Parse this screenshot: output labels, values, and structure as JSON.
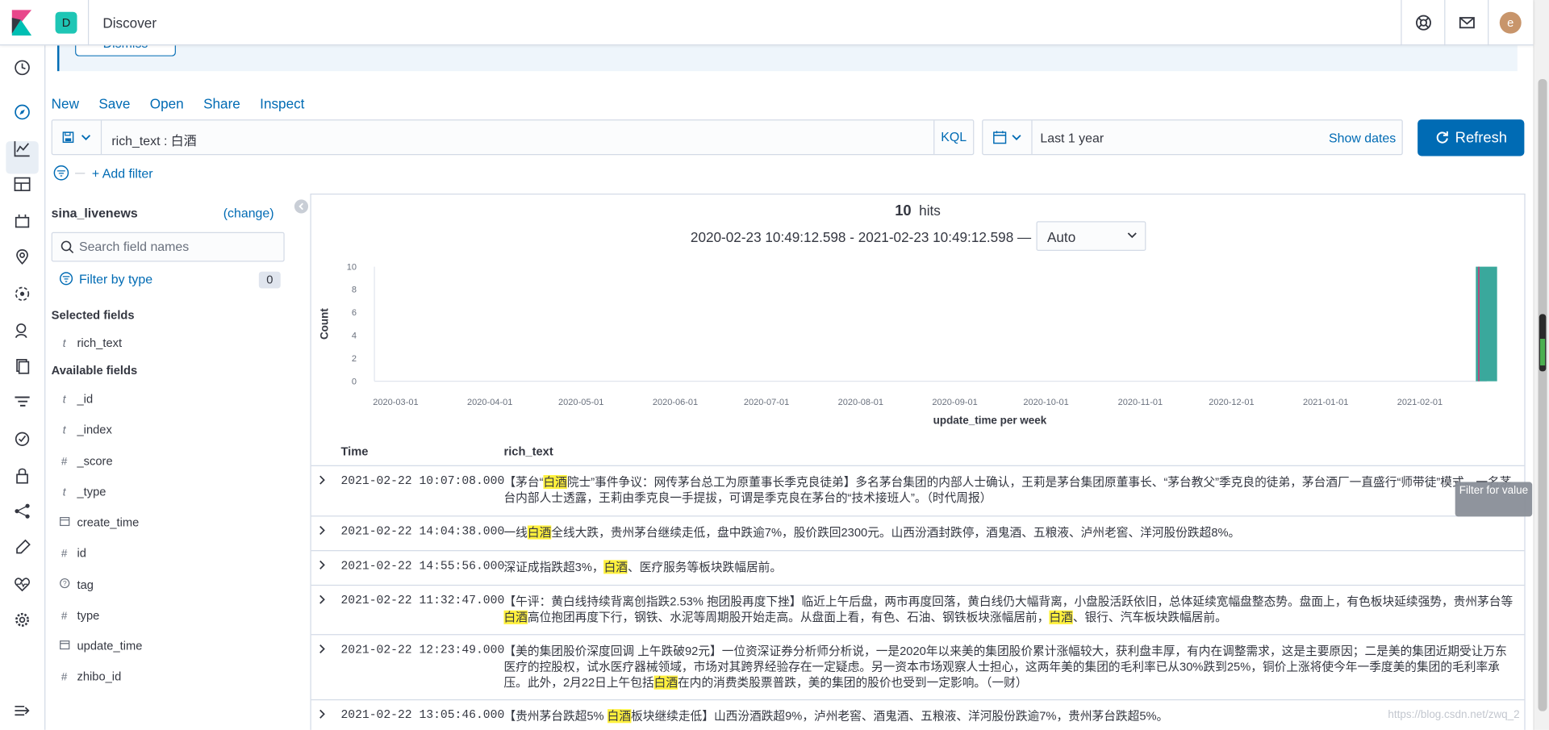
{
  "header": {
    "space_initial": "D",
    "title": "Discover",
    "user_initial": "e"
  },
  "callout": {
    "dismiss_label": "Dismiss"
  },
  "top_menu": [
    "New",
    "Save",
    "Open",
    "Share",
    "Inspect"
  ],
  "query": {
    "text": "rich_text : 白酒",
    "language": "KQL"
  },
  "date": {
    "range": "Last 1 year",
    "show_dates": "Show dates"
  },
  "refresh_label": "Refresh",
  "add_filter": "+ Add filter",
  "sidebar": {
    "index_pattern": "sina_livenews",
    "change": "(change)",
    "search_placeholder": "Search field names",
    "filter_by_type": "Filter by type",
    "filter_count": "0",
    "selected_title": "Selected fields",
    "selected_fields": [
      {
        "type": "t",
        "name": "rich_text"
      }
    ],
    "available_title": "Available fields",
    "available_fields": [
      {
        "type": "t",
        "name": "_id"
      },
      {
        "type": "t",
        "name": "_index"
      },
      {
        "type": "#",
        "name": "_score"
      },
      {
        "type": "t",
        "name": "_type"
      },
      {
        "type": "date",
        "name": "create_time"
      },
      {
        "type": "#",
        "name": "id"
      },
      {
        "type": "?",
        "name": "tag"
      },
      {
        "type": "#",
        "name": "type"
      },
      {
        "type": "date",
        "name": "update_time"
      },
      {
        "type": "#",
        "name": "zhibo_id"
      }
    ]
  },
  "results": {
    "hits": "10",
    "hits_label": "hits",
    "date_range": "2020-02-23 10:49:12.598 - 2021-02-23 10:49:12.598 —",
    "interval": "Auto"
  },
  "chart_data": {
    "type": "bar",
    "ylabel": "Count",
    "xlabel": "update_time per week",
    "ylim": [
      0,
      10
    ],
    "yticks": [
      "0",
      "2",
      "4",
      "6",
      "8",
      "10"
    ],
    "xticks": [
      "2020-03-01",
      "2020-04-01",
      "2020-05-01",
      "2020-06-01",
      "2020-07-01",
      "2020-08-01",
      "2020-09-01",
      "2020-10-01",
      "2020-11-01",
      "2020-12-01",
      "2021-01-01",
      "2021-02-01"
    ],
    "categories": [
      "2021-02-22"
    ],
    "values": [
      10
    ],
    "color": "#3aa89c"
  },
  "table": {
    "columns": [
      "Time",
      "rich_text"
    ],
    "rows": [
      {
        "time": "2021-02-22 10:07:08.000",
        "text": "【茅台“白酒院士”事件争议：网传茅台总工为原董事长季克良徒弟】多名茅台集团的内部人士确认，王莉是茅台集团原董事长、“茅台教父”季克良的徒弟，茅台酒厂一直盛行“师带徒”模式。一名茅台内部人士透露，王莉由季克良一手提拔，可谓是季克良在茅台的“技术接班人”。（时代周报）"
      },
      {
        "time": "2021-02-22 14:04:38.000",
        "text": "一线白酒全线大跌，贵州茅台继续走低，盘中跌逾7%，股价跌回2300元。山西汾酒封跌停，酒鬼酒、五粮液、泸州老窖、洋河股份跌超8%。"
      },
      {
        "time": "2021-02-22 14:55:56.000",
        "text": "深证成指跌超3%，白酒、医疗服务等板块跌幅居前。"
      },
      {
        "time": "2021-02-22 11:32:47.000",
        "text": "【午评：黄白线持续背离创指跌2.53% 抱团股再度下挫】临近上午后盘，两市再度回落，黄白线仍大幅背离，小盘股活跃依旧，总体延续宽幅盘整态势。盘面上，有色板块延续强势，贵州茅台等白酒高位抱团再度下行，钢铁、水泥等周期股开始走高。从盘面上看，有色、石油、钢铁板块涨幅居前，白酒、银行、汽车板块跌幅居前。"
      },
      {
        "time": "2021-02-22 12:23:49.000",
        "text": "【美的集团股价深度回调 上午跌破92元】一位资深证券分析师分析说，一是2020年以来美的集团股价累计涨幅较大，获利盘丰厚，有内在调整需求，这是主要原因；二是美的集团近期受让万东医疗的控股权，试水医疗器械领域，市场对其跨界经验存在一定疑虑。另一资本市场观察人士担心，这两年美的集团的毛利率已从30%跌到25%，铜价上涨将使今年一季度美的集团的毛利率承压。此外，2月22日上午包括白酒在内的消费类股票普跌，美的集团的股价也受到一定影响。（一财）"
      },
      {
        "time": "2021-02-22 13:05:46.000",
        "text": "【贵州茅台跌超5% 白酒板块继续走低】山西汾酒跌超9%，泸州老窖、酒鬼酒、五粮液、洋河股份跌逾7%，贵州茅台跌超5%。"
      }
    ],
    "highlight": "白酒"
  },
  "tooltip": "Filter for value",
  "watermark": "https://blog.csdn.net/zwq_2"
}
